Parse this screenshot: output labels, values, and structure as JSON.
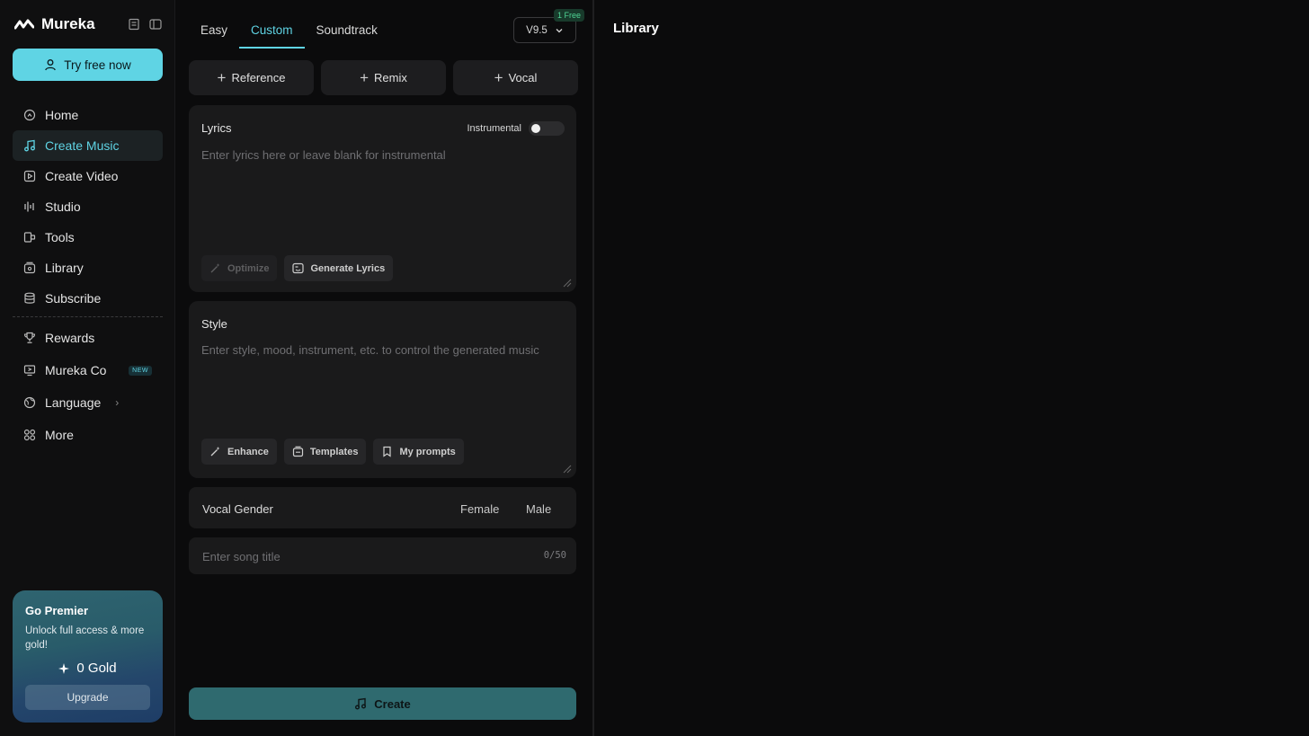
{
  "brand": {
    "name": "Mureka",
    "logo_icon": "mureka-wave-icon"
  },
  "sidebar": {
    "try_button": "Try free now",
    "items": [
      {
        "label": "Home",
        "icon": "home-icon"
      },
      {
        "label": "Create Music",
        "icon": "music-note-icon",
        "active": true
      },
      {
        "label": "Create Video",
        "icon": "video-icon"
      },
      {
        "label": "Studio",
        "icon": "studio-icon"
      },
      {
        "label": "Tools",
        "icon": "tools-icon"
      },
      {
        "label": "Library",
        "icon": "library-icon"
      },
      {
        "label": "Subscribe",
        "icon": "database-icon"
      }
    ],
    "secondary_items": [
      {
        "label": "Rewards",
        "icon": "trophy-icon"
      },
      {
        "label": "Mureka Co",
        "icon": "monitor-icon",
        "badge": "NEW"
      },
      {
        "label": "Language",
        "icon": "globe-icon",
        "chevron": "›"
      },
      {
        "label": "More",
        "icon": "grid-icon"
      }
    ],
    "premier": {
      "title": "Go Premier",
      "description": "Unlock full access & more gold!",
      "gold": "0 Gold",
      "upgrade": "Upgrade"
    }
  },
  "create": {
    "tabs": [
      "Easy",
      "Custom",
      "Soundtrack"
    ],
    "active_tab": "Custom",
    "version": "V9.5",
    "free_badge": "1 Free",
    "reference_buttons": [
      "Reference",
      "Remix",
      "Vocal"
    ],
    "lyrics": {
      "title": "Lyrics",
      "instrumental_label": "Instrumental",
      "instrumental_on": false,
      "placeholder": "Enter lyrics here or leave blank for instrumental",
      "optimize": "Optimize",
      "generate": "Generate Lyrics"
    },
    "style": {
      "title": "Style",
      "placeholder": "Enter style, mood, instrument, etc. to control the generated music",
      "enhance": "Enhance",
      "templates": "Templates",
      "my_prompts": "My prompts"
    },
    "vocal_gender": {
      "label": "Vocal Gender",
      "female": "Female",
      "male": "Male"
    },
    "song_title": {
      "placeholder": "Enter song title",
      "counter": "0/50"
    },
    "create_button": "Create"
  },
  "library": {
    "title": "Library"
  },
  "colors": {
    "accent": "#5fd4e4",
    "background": "#0b0b0c",
    "panel": "#1a1a1b",
    "create": "#2f6a6f"
  }
}
